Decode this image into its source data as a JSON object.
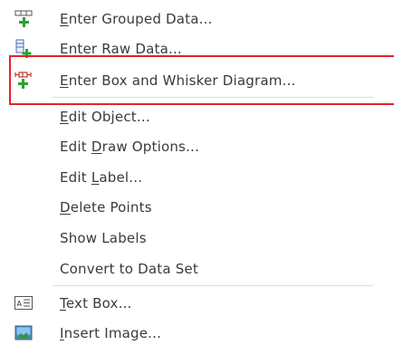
{
  "menu": {
    "items": [
      {
        "id": "enter-grouped-data",
        "pre": "",
        "mn": "E",
        "post": "nter Grouped Data..."
      },
      {
        "id": "enter-raw-data",
        "pre": "",
        "mn": "E",
        "post": "nter Raw Data..."
      },
      {
        "id": "enter-box-whisker",
        "pre": "",
        "mn": "E",
        "post": "nter Box and Whisker Diagram..."
      },
      {
        "id": "edit-object",
        "pre": "",
        "mn": "E",
        "post": "dit Object..."
      },
      {
        "id": "edit-draw-options",
        "pre": "Edit ",
        "mn": "D",
        "post": "raw Options..."
      },
      {
        "id": "edit-label",
        "pre": "Edit ",
        "mn": "L",
        "post": "abel..."
      },
      {
        "id": "delete-points",
        "pre": "",
        "mn": "D",
        "post": "elete Points"
      },
      {
        "id": "show-labels",
        "pre": "Show Labels",
        "mn": "",
        "post": ""
      },
      {
        "id": "convert-to-data-set",
        "pre": "Convert to Data Set",
        "mn": "",
        "post": ""
      },
      {
        "id": "text-box",
        "pre": "",
        "mn": "T",
        "post": "ext Box..."
      },
      {
        "id": "insert-image",
        "pre": "",
        "mn": "I",
        "post": "nsert Image..."
      }
    ],
    "icons": {
      "enter-grouped-data": "grouped-data-add-icon",
      "enter-raw-data": "raw-data-add-icon",
      "enter-box-whisker": "box-whisker-add-icon",
      "text-box": "text-box-icon",
      "insert-image": "image-icon"
    },
    "colors": {
      "text": "#3a3a3a",
      "highlight_border": "#e3232b",
      "plus_green": "#2fa12f",
      "separator": "#dcdcdc"
    }
  }
}
